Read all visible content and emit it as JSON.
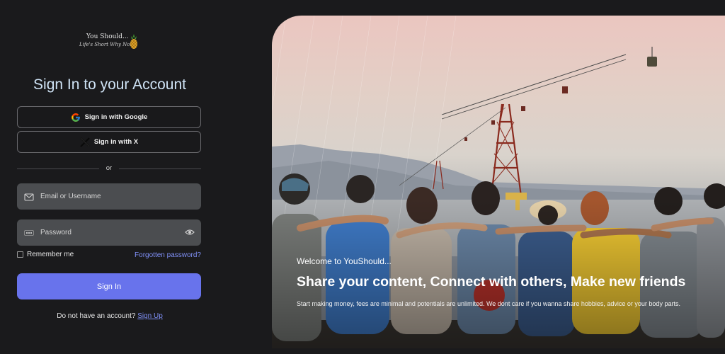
{
  "brand": {
    "name": "You Should...",
    "tagline": "Life's Short Why Not",
    "logo_icon": "pineapple-icon"
  },
  "form": {
    "title": "Sign In to your Account",
    "google_label": "Sign in with Google",
    "x_label": "Sign in with X",
    "divider_text": "or",
    "email_placeholder": "Email or Username",
    "email_value": "",
    "password_placeholder": "Password",
    "password_value": "",
    "remember_label": "Remember me",
    "remember_checked": false,
    "forgot_label": "Forgotten password?",
    "submit_label": "Sign In",
    "signup_prompt": "Do not have an account?",
    "signup_link": "Sign Up"
  },
  "hero": {
    "welcome": "Welcome to YouShould...",
    "headline": "Share your content, Connect with others, Make new friends",
    "description": "Start making money, fees are minimal and potentials are unlimited. We dont care if you wanna share hobbies, advice or your body parts."
  },
  "colors": {
    "background": "#1a1a1c",
    "accent": "#6873ec",
    "link": "#7f8ff5",
    "title": "#cfe3f5",
    "input_bg": "#4b4d50"
  }
}
